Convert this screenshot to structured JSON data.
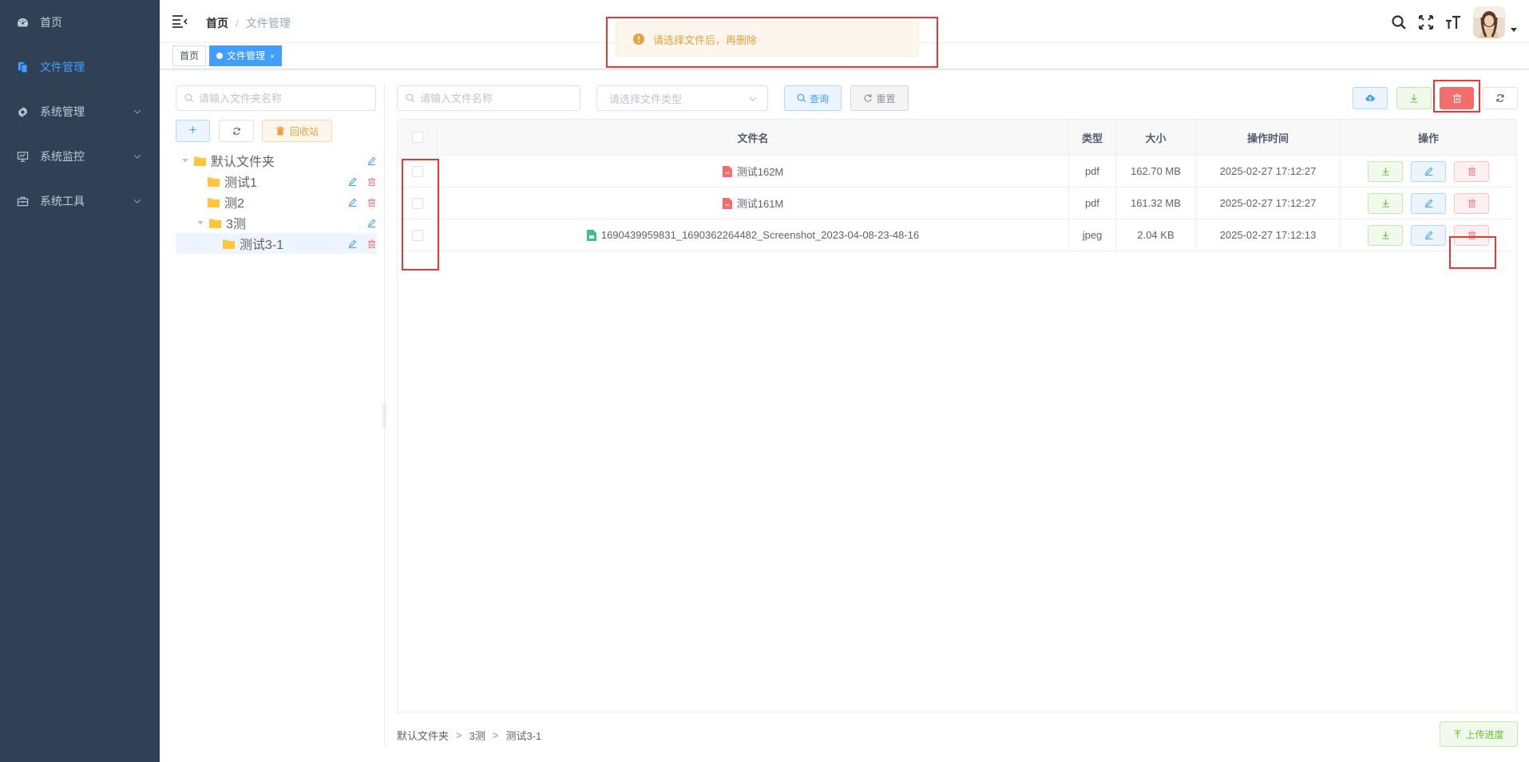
{
  "sidebar": {
    "items": [
      {
        "label": "首页"
      },
      {
        "label": "文件管理"
      },
      {
        "label": "系统管理"
      },
      {
        "label": "系统监控"
      },
      {
        "label": "系统工具"
      }
    ]
  },
  "navbar": {
    "breadcrumb": {
      "home": "首页",
      "separator": "/",
      "current": "文件管理"
    }
  },
  "tags": {
    "home": "首页",
    "current": "文件管理",
    "close": "×"
  },
  "message": {
    "text": "请选择文件后，再删除",
    "type": "warning"
  },
  "folder_panel": {
    "search_placeholder": "请输入文件夹名称",
    "add_label": "+",
    "recycle_label": "回收站",
    "tree": [
      {
        "label": "默认文件夹",
        "level": 0,
        "expanded": true
      },
      {
        "label": "测试1",
        "level": 1
      },
      {
        "label": "测2",
        "level": 1
      },
      {
        "label": "3测",
        "level": 1,
        "expanded": true
      },
      {
        "label": "测试3-1",
        "level": 2,
        "selected": true
      }
    ]
  },
  "file_panel": {
    "search_placeholder": "请输入文件名称",
    "type_placeholder": "请选择文件类型",
    "query_label": "查询",
    "reset_label": "重置"
  },
  "table": {
    "columns": {
      "name": "文件名",
      "type": "类型",
      "size": "大小",
      "time": "操作时间",
      "ops": "操作"
    },
    "rows": [
      {
        "name": "测试162M",
        "type": "pdf",
        "size": "162.70 MB",
        "time": "2025-02-27 17:12:27",
        "icon": "pdf-file-icon"
      },
      {
        "name": "测试161M",
        "type": "pdf",
        "size": "161.32 MB",
        "time": "2025-02-27 17:12:27",
        "icon": "pdf-file-icon"
      },
      {
        "name": "1690439959831_1690362264482_Screenshot_2023-04-08-23-48-16",
        "type": "jpeg",
        "size": "2.04 KB",
        "time": "2025-02-27 17:12:13",
        "icon": "image-file-icon"
      }
    ]
  },
  "footer": {
    "path": [
      "默认文件夹",
      "3测",
      "测试3-1"
    ],
    "separator": ">",
    "progress_label": "上传进度"
  },
  "colors": {
    "sidebar_bg": "#304156",
    "primary": "#409eff",
    "danger": "#f56c6c",
    "success": "#67c23a",
    "warning": "#e6a23c",
    "highlight": "#e53935"
  }
}
